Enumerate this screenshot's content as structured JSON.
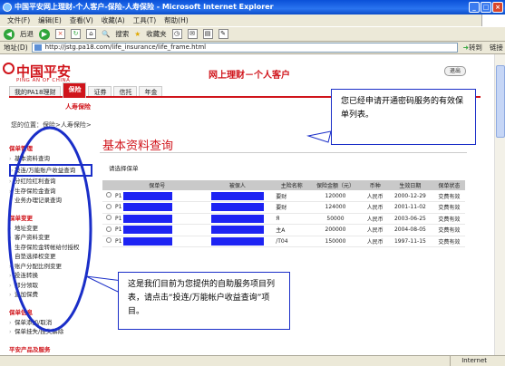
{
  "window": {
    "title": "中国平安网上理财-个人客户-保险-人寿保险 - Microsoft Internet Explorer"
  },
  "menu": [
    "文件(F)",
    "编辑(E)",
    "查看(V)",
    "收藏(A)",
    "工具(T)",
    "帮助(H)"
  ],
  "toolbar": {
    "back": "后退",
    "search": "搜索",
    "favorites": "收藏夹"
  },
  "address": {
    "label": "地址(D)",
    "url": "http://jstg.pa18.com/life_insurance/life_frame.html",
    "go": "转到",
    "links": "链接"
  },
  "header": {
    "logo": "中国平安",
    "logo_sub": "PING AN OF CHINA",
    "site_title": "网上理财－个人客户",
    "exit": "退出"
  },
  "nav": {
    "tabs": [
      "我的PA18理财",
      "保险",
      "证券",
      "信托",
      "年金"
    ],
    "active_index": 1,
    "sub": "人寿保险"
  },
  "breadcrumb": "您的位置：保险>人寿保险>",
  "sidebar": {
    "sections": [
      {
        "title": "保单管理",
        "items": [
          "基本资料查询",
          "投连/万能账户收益查询",
          "分红险红利查询",
          "生存保险金查询",
          "业务办理记录查询"
        ]
      },
      {
        "title": "保单变更",
        "items": [
          "地址变更",
          "客户资料变更",
          "生存保险金转帐给付授权",
          "自垫选择权变更",
          "账户分配比例变更",
          "投连转换",
          "部分领取",
          "追加保费"
        ]
      },
      {
        "title": "保单信息",
        "items": [
          "保单添加/取消",
          "保单挂失/挂失解除"
        ]
      },
      {
        "title": "平安产品及服务",
        "items": []
      }
    ],
    "selected": "投连/万能账户收益查询"
  },
  "main": {
    "title": "基本资料查询",
    "select_label": "请选择保单",
    "columns": [
      "保单号",
      "被保人",
      "主险名称",
      "保险金额（元）",
      "币种",
      "生效日期",
      "保单状态"
    ],
    "rows": [
      {
        "policy_prefix": "P1",
        "product_suffix": "要财",
        "amount": "120000",
        "currency": "人民币",
        "date": "2000-12-29",
        "status": "交费有效"
      },
      {
        "policy_prefix": "P1",
        "product_suffix": "要财",
        "amount": "124000",
        "currency": "人民币",
        "date": "2001-11-02",
        "status": "交费有效"
      },
      {
        "policy_prefix": "P1",
        "product_suffix": "Я",
        "amount": "50000",
        "currency": "人民币",
        "date": "2003-06-25",
        "status": "交费有效"
      },
      {
        "policy_prefix": "P1",
        "product_suffix": "主A",
        "amount": "200000",
        "currency": "人民币",
        "date": "2004-08-05",
        "status": "交费有效"
      },
      {
        "policy_prefix": "P1",
        "product_suffix": "/T04",
        "amount": "150000",
        "currency": "人民币",
        "date": "1997-11-15",
        "status": "交费有效"
      }
    ]
  },
  "callouts": {
    "top": "您已经申请开通密码服务的有效保单列表。",
    "bottom": "这是我们目前为您提供的自助服务项目列表，请点击“投连/万能帐户收益查询”项目。"
  },
  "status": {
    "zone": "Internet"
  },
  "colors": {
    "brand_red": "#d0141b",
    "annotation_blue": "#1a2ec8",
    "mask_blue": "#1d23f3"
  }
}
